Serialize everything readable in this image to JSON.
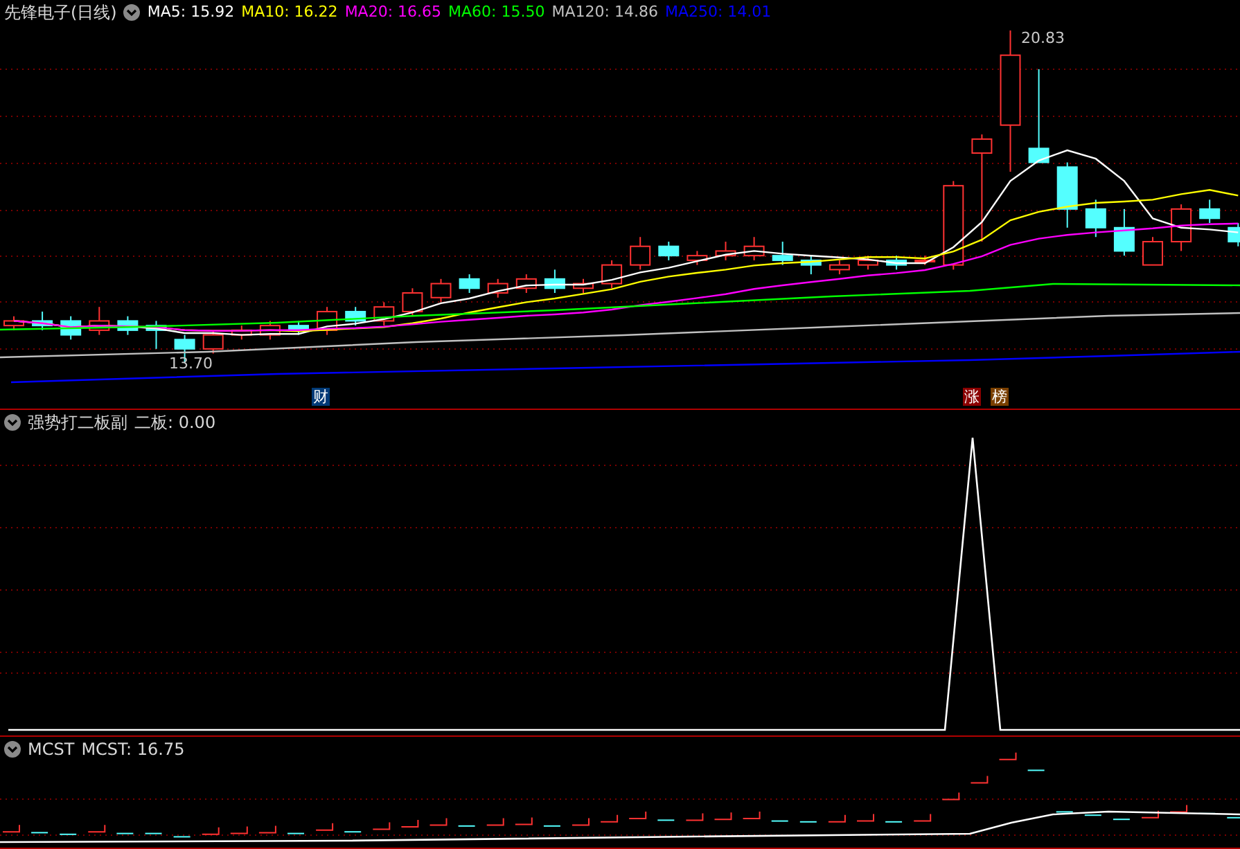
{
  "main_panel": {
    "title": "先锋电子(日线)",
    "indicators": [
      {
        "label": "MA5: 15.92",
        "color": "#ffffff"
      },
      {
        "label": "MA10: 16.22",
        "color": "#ffff00"
      },
      {
        "label": "MA20: 16.65",
        "color": "#ff00ff"
      },
      {
        "label": "MA60: 15.50",
        "color": "#00ff00"
      },
      {
        "label": "MA120: 14.86",
        "color": "#c0c0c0"
      },
      {
        "label": "MA250: 14.01",
        "color": "#0000ff"
      }
    ],
    "high_label": "20.83",
    "low_label": "13.70",
    "markers": [
      {
        "text": "财",
        "color": "#003a78"
      },
      {
        "text": "涨",
        "color": "#8b0000"
      },
      {
        "text": "榜",
        "color": "#7a4000"
      }
    ]
  },
  "second_panel": {
    "title": "强势打二板副",
    "reading": "二板: 0.00"
  },
  "third_panel": {
    "title": "MCST",
    "reading": "MCST: 16.75"
  }
}
